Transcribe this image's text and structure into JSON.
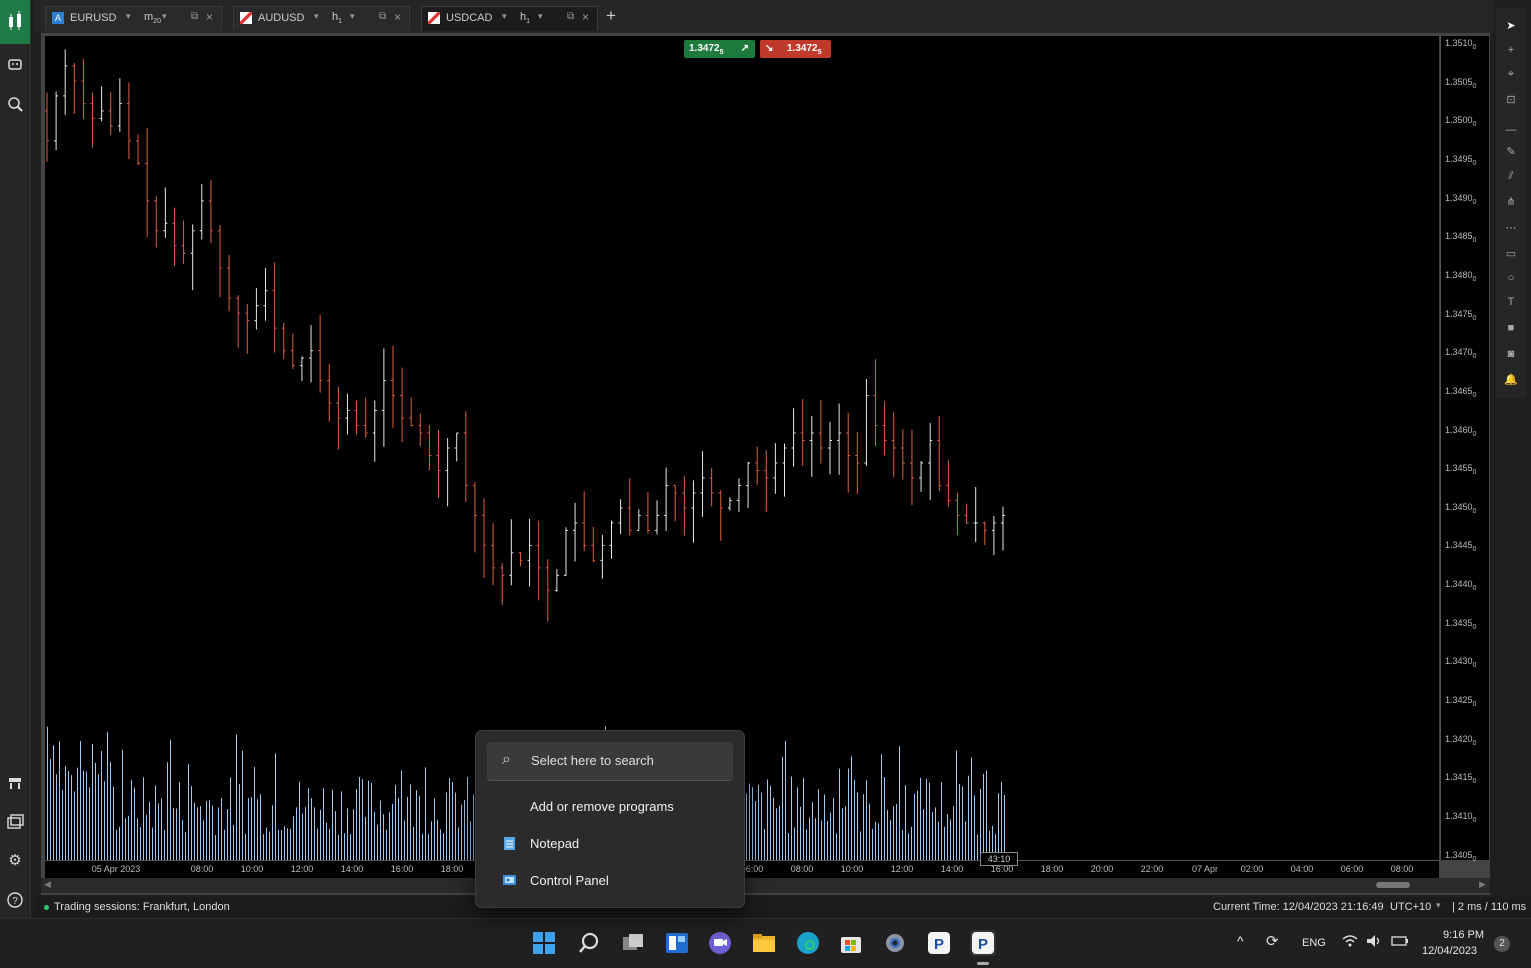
{
  "tabs": [
    {
      "symbol": "EURUSD",
      "timeframe": "m",
      "timeframe_sub": "20",
      "active": false
    },
    {
      "symbol": "AUDUSD",
      "timeframe": "h",
      "timeframe_sub": "1",
      "active": false
    },
    {
      "symbol": "USDCAD",
      "timeframe": "h",
      "timeframe_sub": "1",
      "active": true
    }
  ],
  "new_tab_label": "+",
  "chart": {
    "bid_price": "1.3472",
    "bid_price_sub": "5",
    "ask_price": "1.3472",
    "ask_price_sub": "5",
    "bar_countdown": "43:10",
    "y_ticks": [
      {
        "main": "1.3510",
        "sub": "0"
      },
      {
        "main": "1.3505",
        "sub": "0"
      },
      {
        "main": "1.3500",
        "sub": "0"
      },
      {
        "main": "1.3495",
        "sub": "0"
      },
      {
        "main": "1.3490",
        "sub": "0"
      },
      {
        "main": "1.3485",
        "sub": "0"
      },
      {
        "main": "1.3480",
        "sub": "0"
      },
      {
        "main": "1.3475",
        "sub": "0"
      },
      {
        "main": "1.3470",
        "sub": "0"
      },
      {
        "main": "1.3465",
        "sub": "0"
      },
      {
        "main": "1.3460",
        "sub": "0"
      },
      {
        "main": "1.3455",
        "sub": "0"
      },
      {
        "main": "1.3450",
        "sub": "0"
      },
      {
        "main": "1.3445",
        "sub": "0"
      },
      {
        "main": "1.3440",
        "sub": "0"
      },
      {
        "main": "1.3435",
        "sub": "0"
      },
      {
        "main": "1.3430",
        "sub": "0"
      },
      {
        "main": "1.3425",
        "sub": "0"
      },
      {
        "main": "1.3420",
        "sub": "0"
      },
      {
        "main": "1.3415",
        "sub": "0"
      },
      {
        "main": "1.3410",
        "sub": "0"
      },
      {
        "main": "1.3405",
        "sub": "0"
      }
    ],
    "x_ticks": [
      "05 Apr 2023",
      "08:00",
      "10:00",
      "12:00",
      "14:00",
      "16:00",
      "18:00",
      "06:00",
      "08:00",
      "10:00",
      "12:00",
      "14:00",
      "16:00",
      "18:00",
      "20:00",
      "22:00",
      "07 Apr",
      "02:00",
      "04:00",
      "06:00",
      "08:00"
    ],
    "colors": {
      "bull": "#e8e8e8",
      "bear": "#e0603c",
      "volume": "#9ec9ef",
      "background": "#000000"
    },
    "y_range": [
      1.3402,
      1.3512
    ],
    "close_series": [
      1.3498,
      1.3504,
      1.3508,
      1.3506,
      1.3503,
      1.3501,
      1.3502,
      1.35,
      1.3503,
      1.3498,
      1.3495,
      1.349,
      1.3486,
      1.3487,
      1.3484,
      1.3483,
      1.3486,
      1.349,
      1.3486,
      1.3481,
      1.3477,
      1.3475,
      1.3474,
      1.3476,
      1.3478,
      1.3473,
      1.347,
      1.3468,
      1.3469,
      1.347,
      1.3466,
      1.3463,
      1.3461,
      1.3462,
      1.346,
      1.3459,
      1.3462,
      1.3466,
      1.3464,
      1.3461,
      1.346,
      1.3459,
      1.3456,
      1.3454,
      1.3457,
      1.3459,
      1.3452,
      1.3448,
      1.3444,
      1.3441,
      1.344,
      1.3443,
      1.3442,
      1.3444,
      1.3441,
      1.3438,
      1.344,
      1.3446,
      1.3447,
      1.3444,
      1.3442,
      1.3444,
      1.3447,
      1.3449,
      1.3446,
      1.3448,
      1.3446,
      1.3448,
      1.3452,
      1.3451,
      1.3449,
      1.3451,
      1.3453,
      1.3451,
      1.3449,
      1.345,
      1.3452,
      1.3455,
      1.3454,
      1.3453,
      1.3455,
      1.3457,
      1.3459,
      1.3458,
      1.3459,
      1.3457,
      1.3458,
      1.3459,
      1.3456,
      1.3455,
      1.3464,
      1.346,
      1.3458,
      1.3457,
      1.3455,
      1.3453,
      1.3455,
      1.3458,
      1.3452,
      1.345,
      1.3448,
      1.3447,
      1.3447,
      1.3446,
      1.3447,
      1.3448
    ]
  },
  "right_tools": [
    "cursor-tool-icon",
    "crosshair-tool-icon",
    "magnet-tool-icon",
    "zoom-tool-icon",
    "line-tool-icon",
    "pen-tool-icon",
    "fibonacci-tool-icon",
    "pitchfork-tool-icon",
    "grid-tool-icon",
    "rectangle-tool-icon",
    "circle-tool-icon",
    "text-tool-icon",
    "fill-tool-icon",
    "camera-tool-icon",
    "alert-tool-icon"
  ],
  "left_tools": [
    "trade-icon",
    "bot-icon",
    "zoom-analyze-icon",
    "market-icon",
    "copy-icon",
    "settings-icon",
    "help-icon"
  ],
  "status": {
    "sessions": "Trading sessions: Frankfurt, London",
    "current_time": "Current Time:  12/04/2023 21:16:49",
    "timezone": "UTC+10",
    "latency": "| 2 ms / 110 ms"
  },
  "popup": {
    "search_placeholder": "Select here to search",
    "items": [
      "Add or remove programs",
      "Notepad",
      "Control Panel"
    ]
  },
  "taskbar": {
    "language": "ENG",
    "time": "9:16 PM",
    "date": "12/04/2023",
    "notification_count": "2"
  }
}
